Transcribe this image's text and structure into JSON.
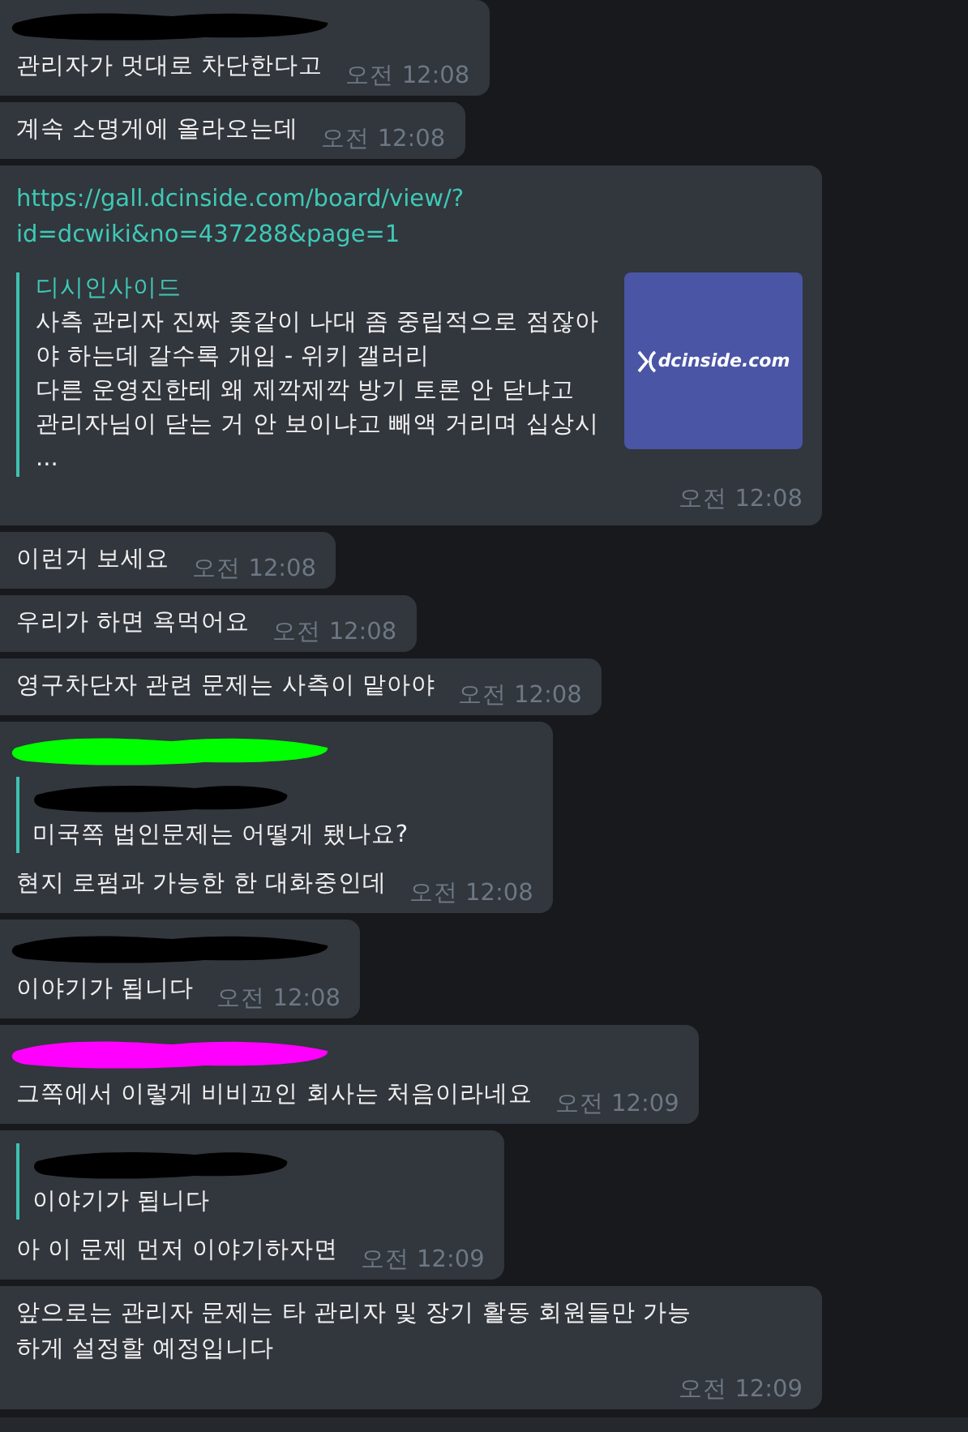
{
  "messages": [
    {
      "sender_redaction": {
        "color": "#000000"
      },
      "text": "관리자가 멋대로 차단한다고",
      "time": "오전 12:08"
    },
    {
      "text": "계속 소명게에 올라오는데",
      "time": "오전 12:08"
    },
    {
      "link": {
        "url": [
          "https://gall.dcinside.com/board/view/?",
          "id=dcwiki&no=437288&page=1"
        ],
        "site": "디시인사이드",
        "title": "사측 관리자 진짜 좆같이 나대 좀 중립적으로 점잖아야 하는데 갈수록 개입 - 위키 갤러리",
        "description": "다른 운영진한테 왜 제깍제깍 방기 토론 안 닫냐고 관리자님이 닫는 거 안  보이냐고 빼액 거리며 십상시 ...",
        "thumbnail_text": "dcinside.com"
      },
      "time": "오전 12:08"
    },
    {
      "text": "이런거 보세요",
      "time": "오전 12:08"
    },
    {
      "text": "우리가 하면 욕먹어요",
      "time": "오전 12:08"
    },
    {
      "text": "영구차단자 관련 문제는 사측이 맡아야",
      "time": "오전 12:08"
    },
    {
      "sender_redaction": {
        "color": "#00ff00"
      },
      "quote": {
        "author_redaction": {
          "color": "#000000"
        },
        "text": "미국쪽 법인문제는 어떻게 됐나요?"
      },
      "text": "현지 로펌과 가능한 한 대화중인데",
      "time": "오전 12:08"
    },
    {
      "sender_redaction": {
        "color": "#000000"
      },
      "text": "이야기가 됩니다",
      "time": "오전 12:08"
    },
    {
      "sender_redaction": {
        "color": "#ff00ff"
      },
      "text": "그쪽에서 이렇게 비비꼬인 회사는 처음이라네요",
      "time": "오전 12:09"
    },
    {
      "quote": {
        "author_redaction": {
          "color": "#000000"
        },
        "text": "이야기가 됩니다"
      },
      "text": "아 이 문제 먼저 이야기하자면",
      "time": "오전 12:09"
    },
    {
      "text": "앞으로는 관리자 문제는 타 관리자 및 장기 활동 회원들만 가능하게 설정할 예정입니다",
      "time": "오전 12:09"
    }
  ]
}
